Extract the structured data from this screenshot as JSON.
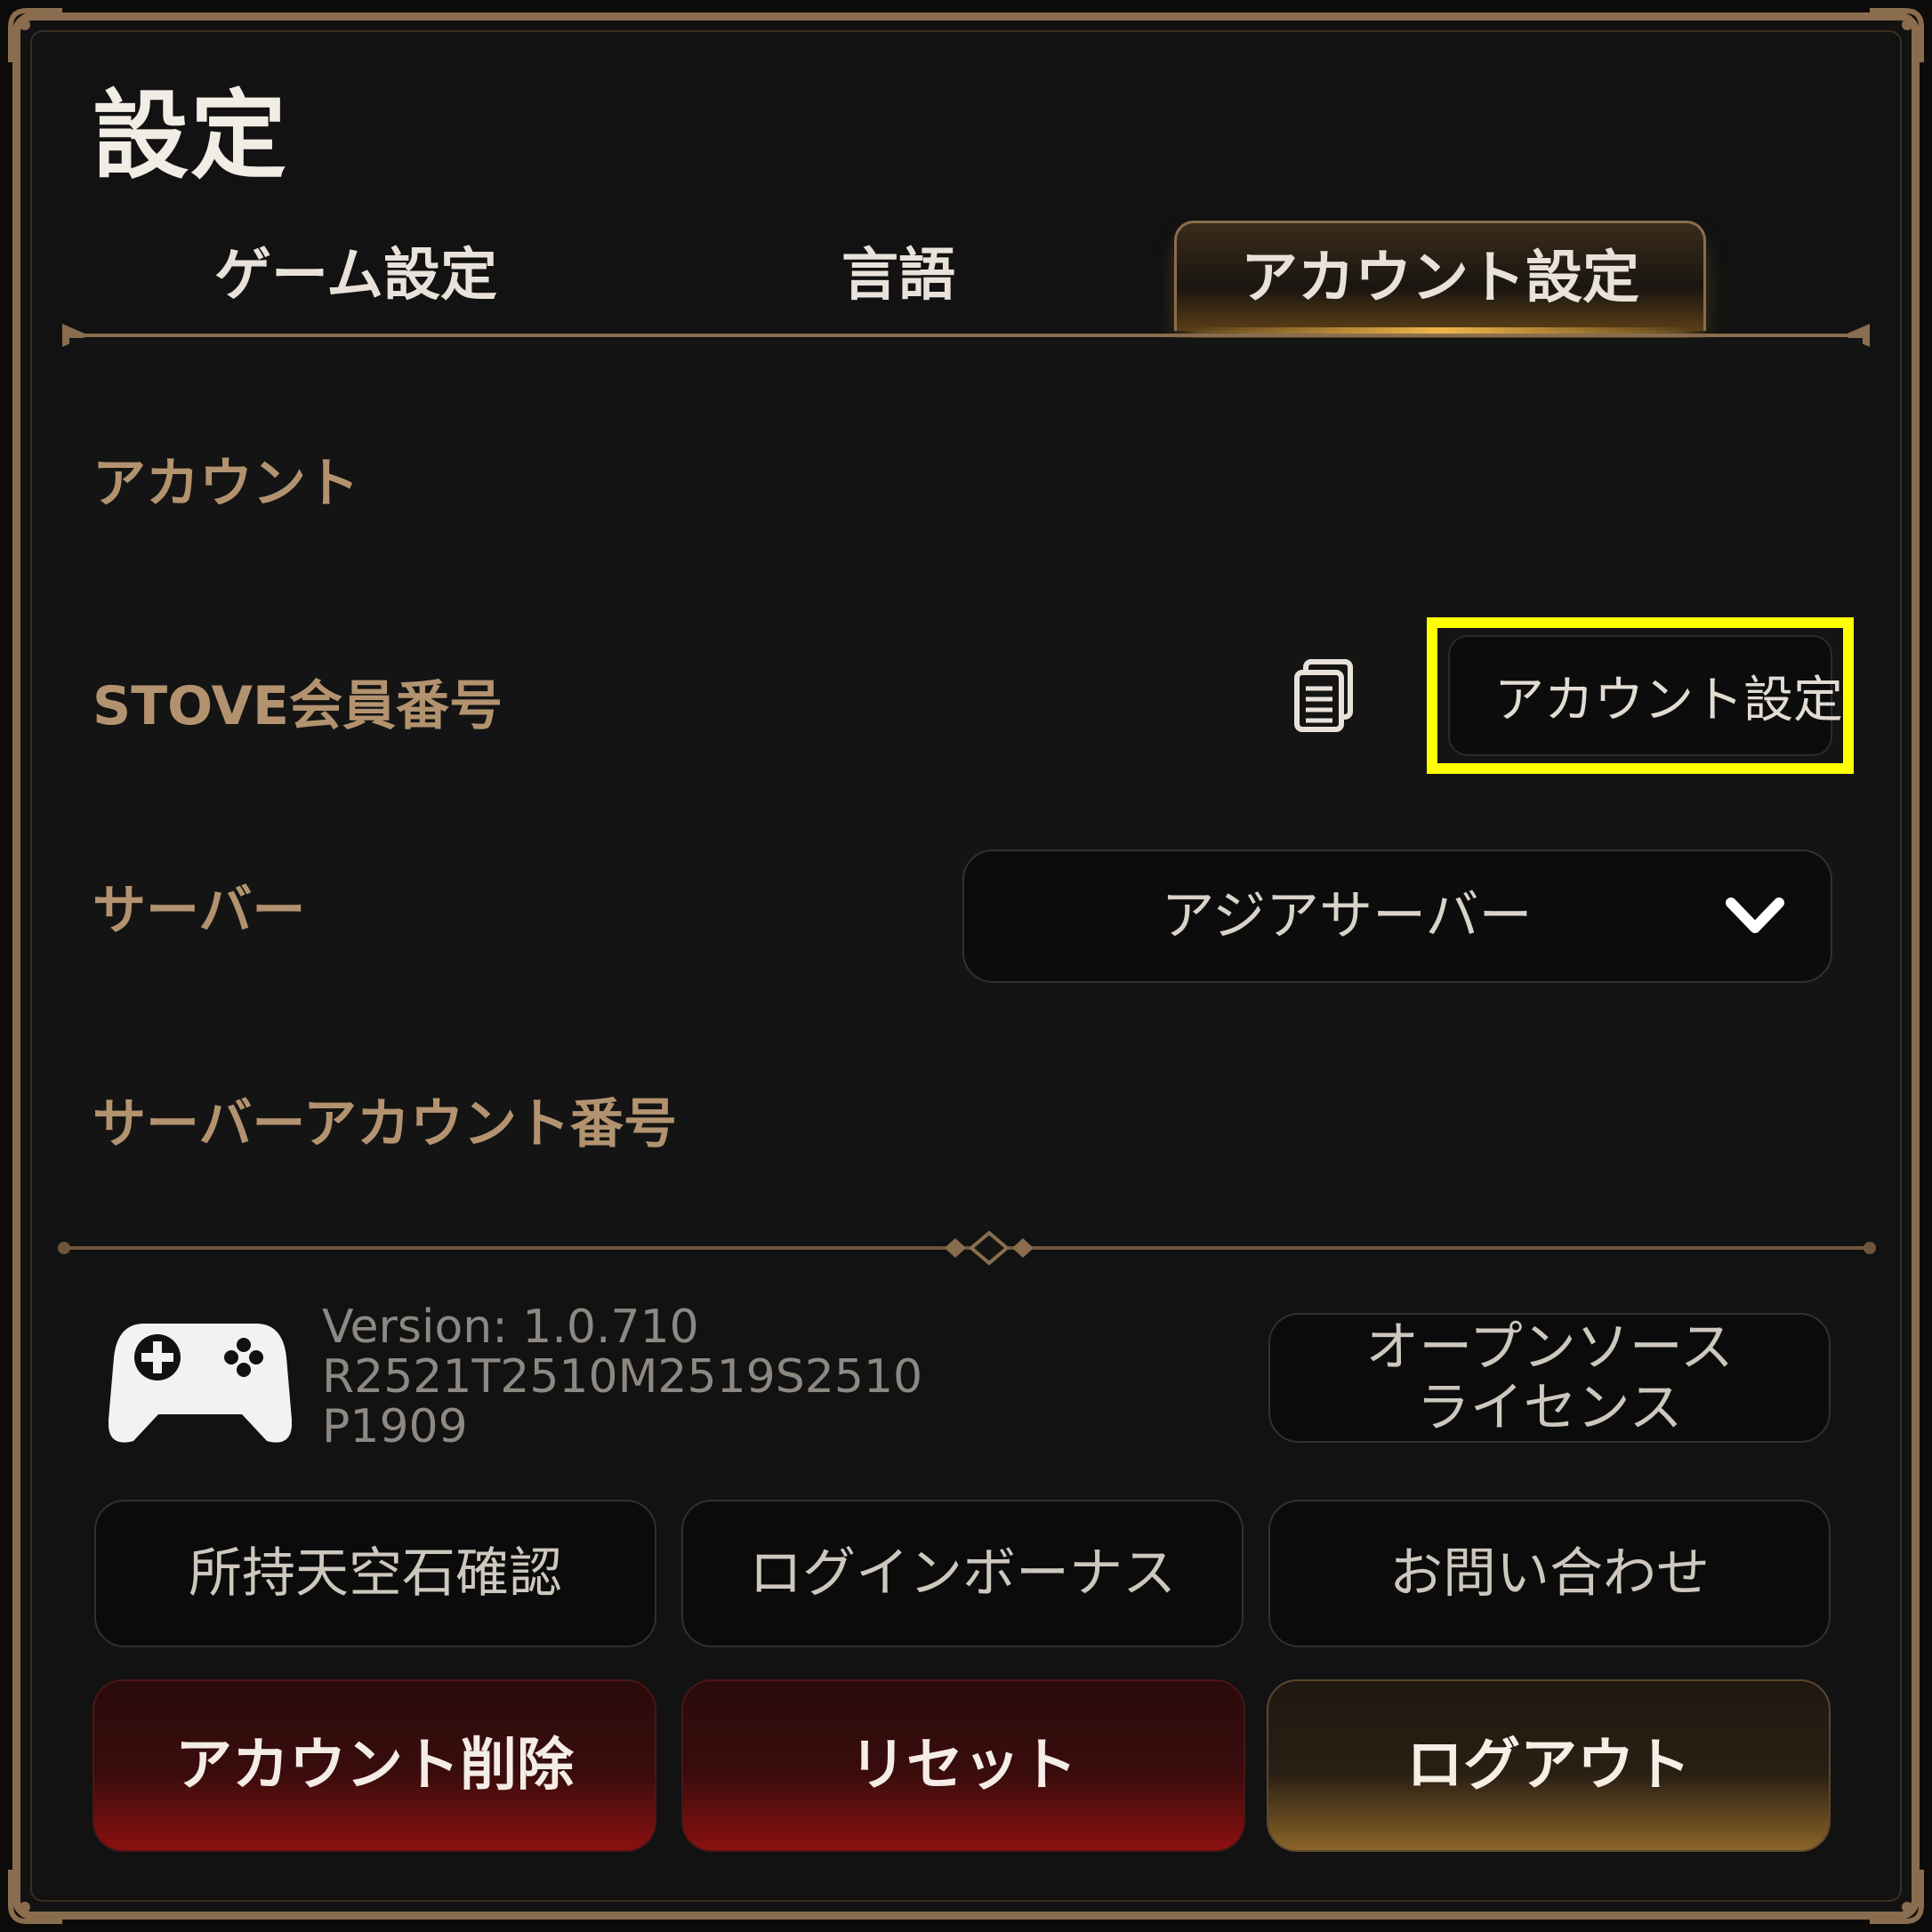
{
  "title": "設定",
  "tabs": [
    {
      "label": "ゲーム設定",
      "active": false
    },
    {
      "label": "言語",
      "active": false
    },
    {
      "label": "アカウント設定",
      "active": true
    }
  ],
  "account": {
    "section_label": "アカウント",
    "stove_label": "STOVE会員番号",
    "stove_button": {
      "label": "アカウント設定",
      "icon": "stove-s-icon"
    },
    "copy_icon": "copy-icon",
    "server_label": "サーバー",
    "server_dropdown": {
      "value": "アジアサーバー",
      "icon": "chevron-down-icon"
    },
    "server_account_label": "サーバーアカウント番号"
  },
  "footer": {
    "gamepad_icon": "gamepad-icon",
    "version_lines": [
      "Version: 1.0.710",
      "R2521T2510M2519S2510",
      "P1909"
    ],
    "oss_button": [
      "オープンソース",
      "ライセンス"
    ],
    "buttons_row1": [
      "所持天空石確認",
      "ログインボーナス",
      "お問い合わせ"
    ],
    "buttons_row2": [
      "アカウント削除",
      "リセット",
      "ログアウト"
    ]
  },
  "colors": {
    "frame_gold": "#8a6d4e",
    "label_gold": "#b3936f",
    "highlight_yellow": "#ffff00",
    "danger_red": "#8c1010",
    "accent_gold": "#f0b64a"
  }
}
